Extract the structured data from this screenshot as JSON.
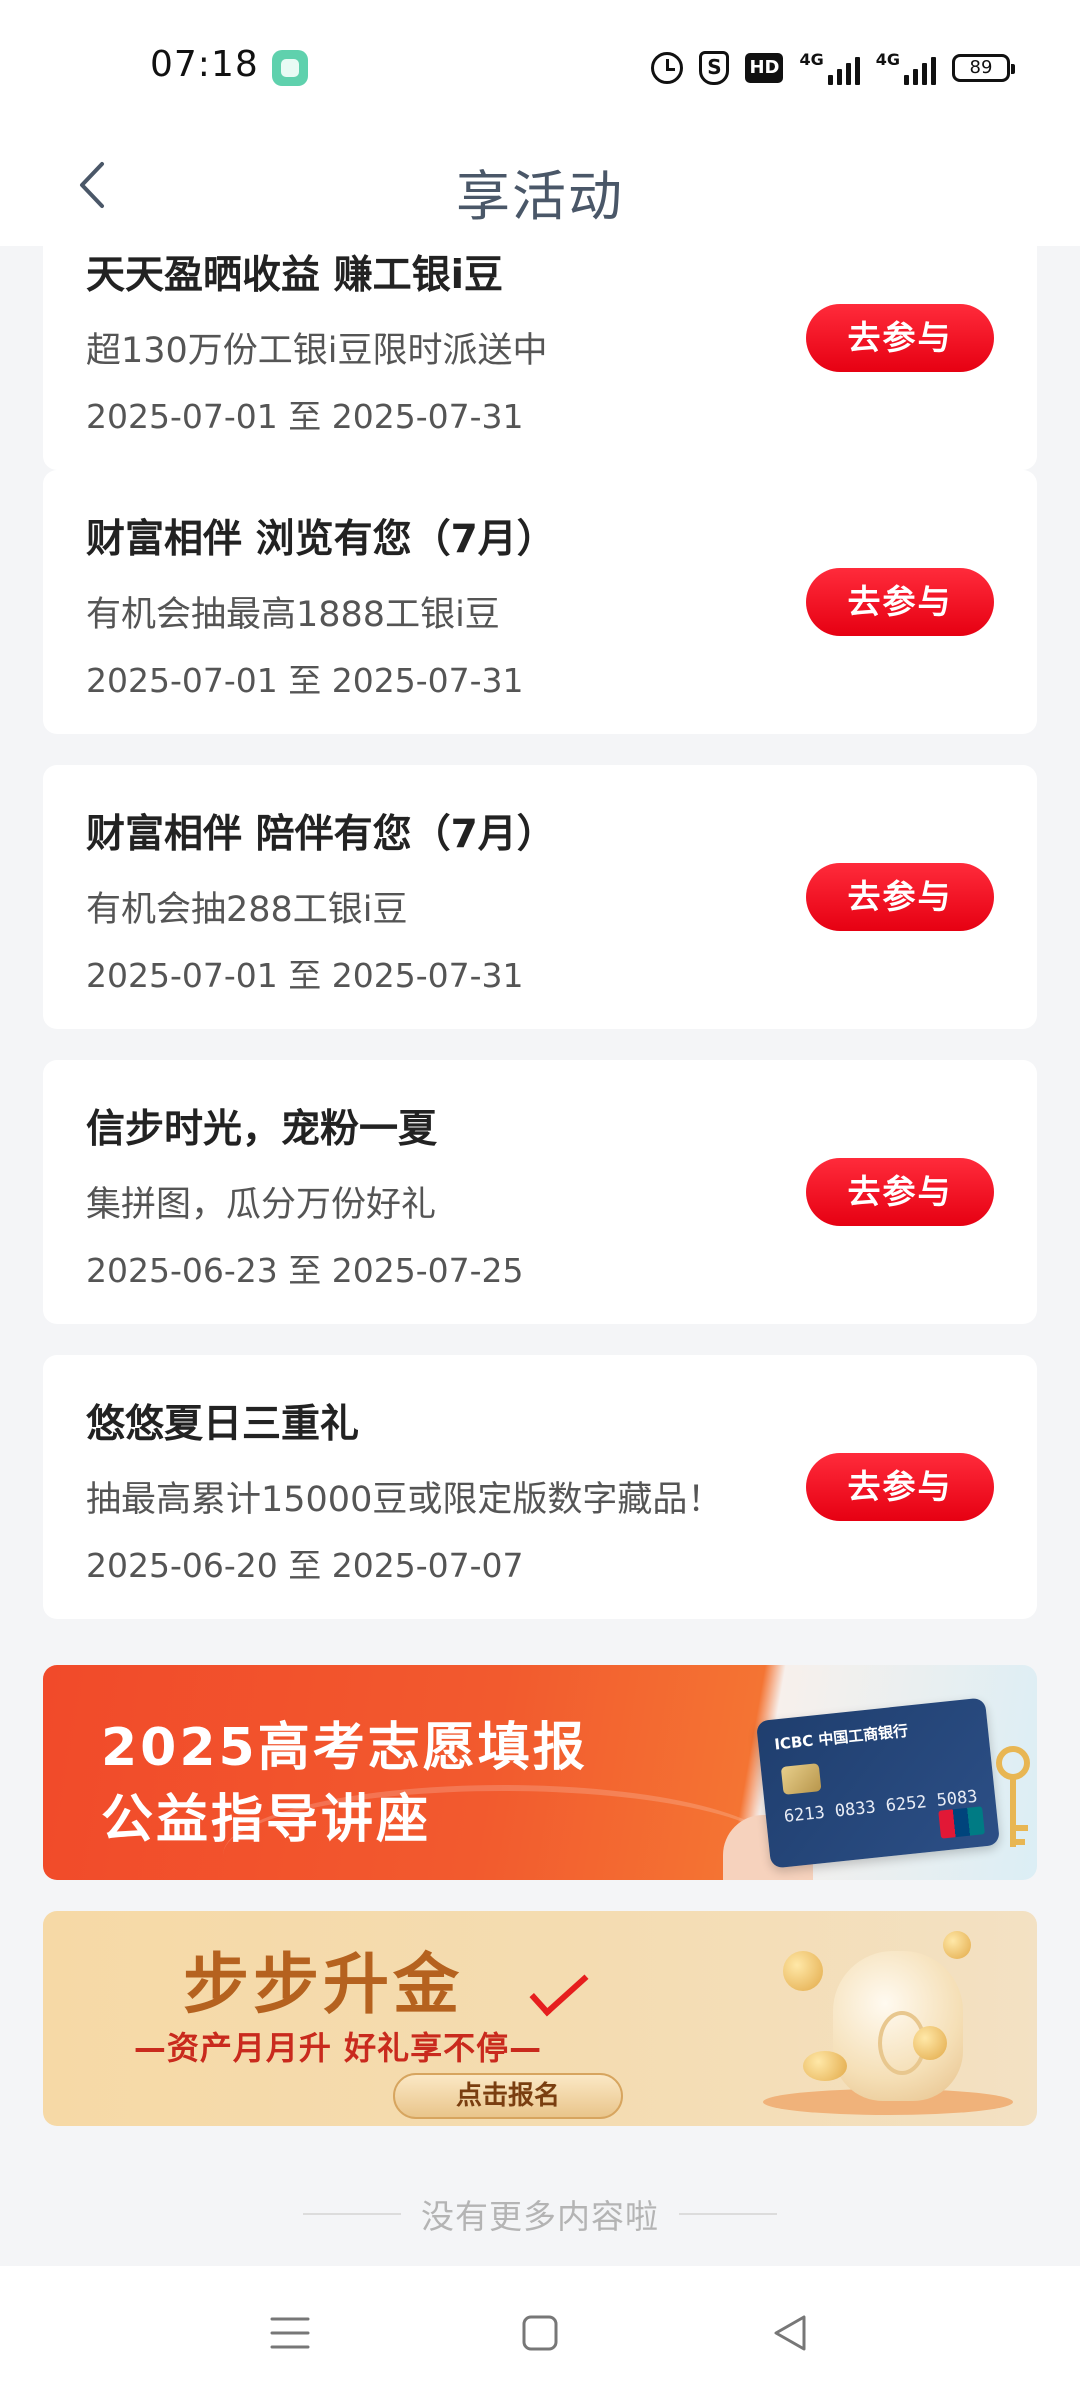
{
  "status_bar": {
    "time": "07:18",
    "network_label_1": "4G",
    "network_label_2": "4G",
    "hd_label": "HD",
    "shield_label": "S",
    "battery": "89"
  },
  "header": {
    "title": "享活动",
    "back_icon": "chevron-left-icon"
  },
  "activities": [
    {
      "title": "天天盈晒收益 赚工银i豆",
      "subtitle": "超130万份工银i豆限时派送中",
      "date": "2025-07-01 至 2025-07-31",
      "button": "去参与"
    },
    {
      "title": "财富相伴 浏览有您（7月）",
      "subtitle": "有机会抽最高1888工银i豆",
      "date": "2025-07-01 至 2025-07-31",
      "button": "去参与"
    },
    {
      "title": "财富相伴 陪伴有您（7月）",
      "subtitle": "有机会抽288工银i豆",
      "date": "2025-07-01 至 2025-07-31",
      "button": "去参与"
    },
    {
      "title": "信步时光，宠粉一夏",
      "subtitle": "集拼图，瓜分万份好礼",
      "date": "2025-06-23 至 2025-07-25",
      "button": "去参与"
    },
    {
      "title": "悠悠夏日三重礼",
      "subtitle": "抽最高累计15000豆或限定版数字藏品！",
      "date": "2025-06-20 至 2025-07-07",
      "button": "去参与"
    }
  ],
  "banners": {
    "gaokao": {
      "line1": "2025高考志愿填报",
      "line2": "公益指导讲座",
      "card_brand": "ICBC 中国工商银行",
      "card_number": "6213 0833 6252 5083"
    },
    "bubu": {
      "title": "步步升金",
      "subtitle": "—资产月月升  好礼享不停—",
      "button": "点击报名"
    }
  },
  "end_notice": "没有更多内容啦",
  "colors": {
    "accent_red": "#e60012",
    "title_gray": "#4a5768",
    "background": "#f4f5f7"
  },
  "nav_bar": {
    "menu_icon": "menu-icon",
    "home_icon": "home-square-icon",
    "back_icon": "back-triangle-icon"
  }
}
